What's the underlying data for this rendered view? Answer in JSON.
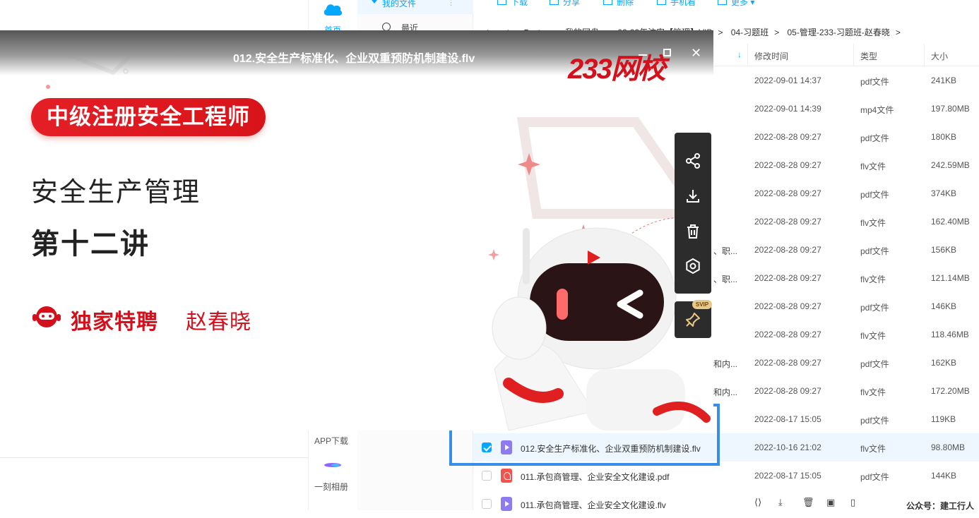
{
  "sidebar": {
    "home_label": "首页",
    "app_download": "APP下载",
    "moment_album": "一刻相册"
  },
  "tree": {
    "my_files": "我的文件",
    "recent": "最近"
  },
  "toolbar": {
    "download": "下载",
    "share": "分享",
    "delete": "删除",
    "phone": "手机看",
    "more": "更多"
  },
  "path": {
    "crumbs": [
      "我的网盘",
      "02-22年注安【管理】VIP",
      "04-习题班",
      "05-管理-233-习题班-赵春晓"
    ],
    "separator": ">"
  },
  "columns": {
    "modified": "修改时间",
    "type": "类型",
    "size": "大小"
  },
  "background_rows": [
    {
      "name": "",
      "date": "2022-09-01 14:37",
      "type": "pdf文件",
      "size": "241KB"
    },
    {
      "name": "",
      "date": "2022-09-01 14:39",
      "type": "mp4文件",
      "size": "197.80MB"
    },
    {
      "name": "",
      "date": "2022-08-28 09:27",
      "type": "pdf文件",
      "size": "180KB"
    },
    {
      "name": "",
      "date": "2022-08-28 09:27",
      "type": "flv文件",
      "size": "242.59MB"
    },
    {
      "name": "",
      "date": "2022-08-28 09:27",
      "type": "pdf文件",
      "size": "374KB"
    },
    {
      "name": "",
      "date": "2022-08-28 09:27",
      "type": "flv文件",
      "size": "162.40MB"
    },
    {
      "name": "、职...",
      "date": "2022-08-28 09:27",
      "type": "pdf文件",
      "size": "156KB"
    },
    {
      "name": "、职...",
      "date": "2022-08-28 09:27",
      "type": "flv文件",
      "size": "121.14MB"
    },
    {
      "name": "",
      "date": "2022-08-28 09:27",
      "type": "pdf文件",
      "size": "146KB"
    },
    {
      "name": "",
      "date": "2022-08-28 09:27",
      "type": "flv文件",
      "size": "118.46MB"
    },
    {
      "name": "和内...",
      "date": "2022-08-28 09:27",
      "type": "pdf文件",
      "size": "162KB"
    },
    {
      "name": "和内...",
      "date": "2022-08-28 09:27",
      "type": "flv文件",
      "size": "172.20MB"
    },
    {
      "name": "",
      "date": "2022-08-17 15:05",
      "type": "pdf文件",
      "size": "119KB"
    }
  ],
  "file_rows": [
    {
      "name": "012.安全生产标准化、企业双重预防机制建设.flv",
      "date": "2022-10-16 21:02",
      "type": "flv文件",
      "size": "98.80MB",
      "kind": "vid",
      "checked": true
    },
    {
      "name": "011.承包商管理、企业安全文化建设.pdf",
      "date": "2022-08-17 15:05",
      "type": "pdf文件",
      "size": "144KB",
      "kind": "pdf",
      "checked": false
    },
    {
      "name": "011.承包商管理、企业安全文化建设.flv",
      "date": "",
      "type": "",
      "size": "",
      "kind": "vid",
      "checked": false
    }
  ],
  "watermark": "公众号：建工行人",
  "video": {
    "title": "012.安全生产标准化、企业双重预防机制建设.flv",
    "brand": "233网校",
    "course_badge": "中级注册安全工程师",
    "subject": "安全生产管理",
    "lecture": "第十二讲",
    "teacher_tag": "独家特聘",
    "teacher_name": "赵春晓"
  },
  "side_tools": {
    "svip": "SVIP",
    "icons": [
      "share-icon",
      "download-icon",
      "delete-icon",
      "settings-icon",
      "pin-icon"
    ]
  },
  "colors": {
    "accent": "#06a7ff",
    "brand_red": "#d3111c",
    "highlight": "#3a8ee6"
  }
}
